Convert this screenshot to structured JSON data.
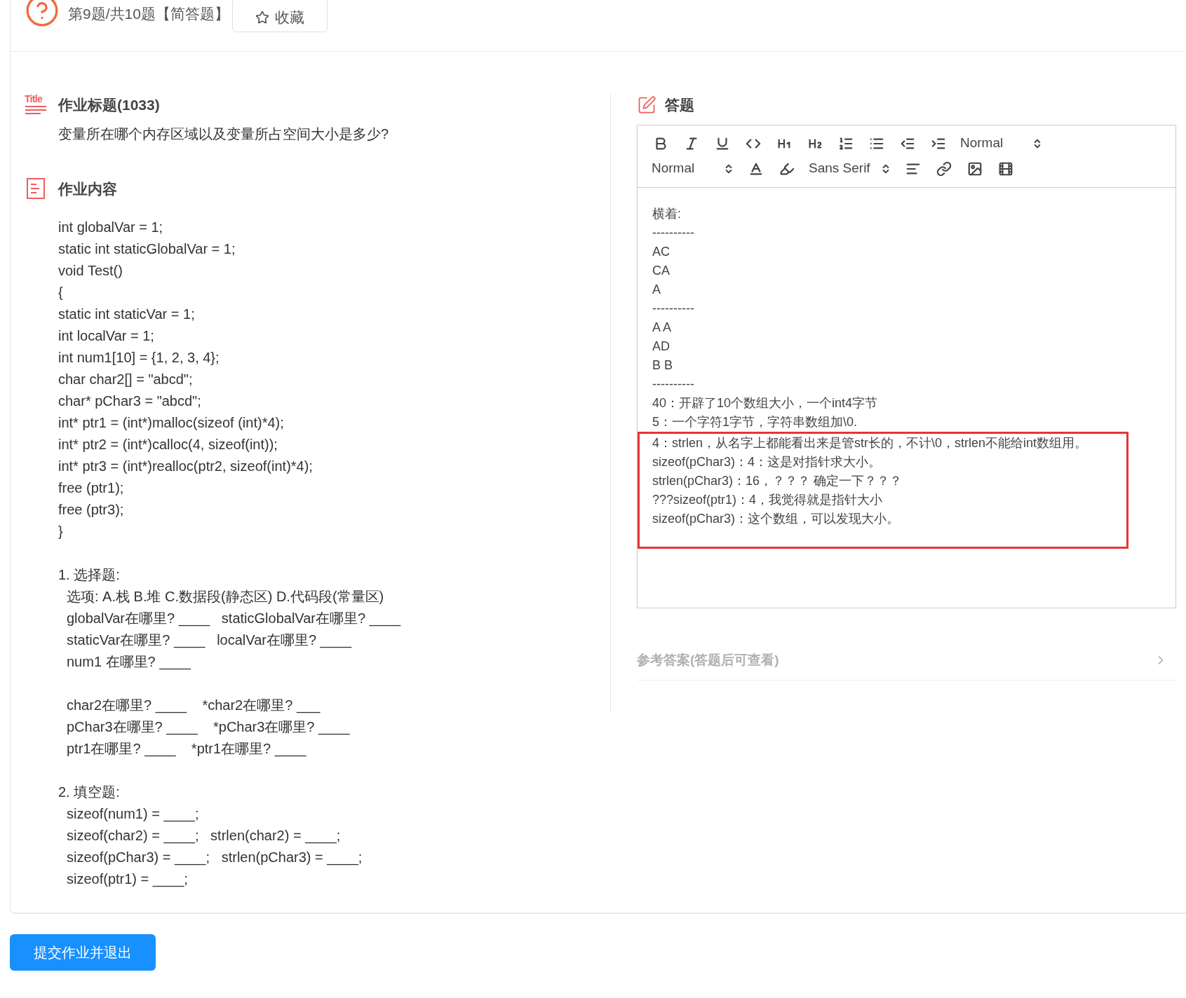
{
  "header": {
    "counter": "第9题/共10题【简答题】",
    "favorite": {
      "label": "收藏",
      "favorited": false
    }
  },
  "question": {
    "icon_label": "Title",
    "title": "作业标题(1033)",
    "text": "变量所在哪个内存区域以及变量所占空间大小是多少?"
  },
  "content": {
    "title": "作业内容",
    "lines": [
      {
        "kind": "code",
        "text": "int globalVar = 1;"
      },
      {
        "kind": "code",
        "text": "static int staticGlobalVar = 1;"
      },
      {
        "kind": "code",
        "text": "void Test()"
      },
      {
        "kind": "code",
        "text": "{"
      },
      {
        "kind": "code",
        "text": "static int staticVar = 1;"
      },
      {
        "kind": "code",
        "text": "int localVar = 1;"
      },
      {
        "kind": "code",
        "text": "int num1[10] = {1, 2, 3, 4};"
      },
      {
        "kind": "code",
        "text": "char char2[] = \"abcd\";"
      },
      {
        "kind": "code",
        "text": "char* pChar3 = \"abcd\";"
      },
      {
        "kind": "code",
        "text": "int* ptr1 = (int*)malloc(sizeof (int)*4);"
      },
      {
        "kind": "code",
        "text": "int* ptr2 = (int*)calloc(4, sizeof(int));"
      },
      {
        "kind": "code",
        "text": "int* ptr3 = (int*)realloc(ptr2, sizeof(int)*4);"
      },
      {
        "kind": "code",
        "text": "free (ptr1);"
      },
      {
        "kind": "code",
        "text": "free (ptr3);"
      },
      {
        "kind": "code",
        "text": "}"
      },
      {
        "kind": "gap"
      },
      {
        "kind": "code",
        "text": "1. 选择题:"
      },
      {
        "kind": "item",
        "text": "选项: A.栈 B.堆 C.数据段(静态区) D.代码段(常量区)"
      },
      {
        "kind": "item",
        "text": "globalVar在哪里? ____   staticGlobalVar在哪里? ____"
      },
      {
        "kind": "item",
        "text": "staticVar在哪里? ____   localVar在哪里? ____"
      },
      {
        "kind": "item",
        "text": "num1 在哪里? ____"
      },
      {
        "kind": "gap"
      },
      {
        "kind": "item",
        "text": "char2在哪里? ____    *char2在哪里? ___"
      },
      {
        "kind": "item",
        "text": "pChar3在哪里? ____    *pChar3在哪里? ____"
      },
      {
        "kind": "item",
        "text": "ptr1在哪里? ____    *ptr1在哪里? ____"
      },
      {
        "kind": "gap"
      },
      {
        "kind": "code",
        "text": "2. 填空题:"
      },
      {
        "kind": "item",
        "text": "sizeof(num1) = ____;"
      },
      {
        "kind": "item",
        "text": "sizeof(char2) = ____;   strlen(char2) = ____;"
      },
      {
        "kind": "item",
        "text": "sizeof(pChar3) = ____;   strlen(pChar3) = ____;"
      },
      {
        "kind": "item",
        "text": "sizeof(ptr1) = ____;"
      }
    ]
  },
  "answer": {
    "title": "答题",
    "toolbar": [
      [
        {
          "kind": "bold"
        },
        {
          "kind": "italic"
        },
        {
          "kind": "underline"
        },
        {
          "kind": "code"
        },
        {
          "kind": "h1"
        },
        {
          "kind": "h2"
        },
        {
          "kind": "ordered"
        },
        {
          "kind": "bullet"
        },
        {
          "kind": "outdent"
        },
        {
          "kind": "indent"
        },
        {
          "kind": "select",
          "label": "Normal"
        }
      ],
      [
        {
          "kind": "select",
          "label": "Normal"
        },
        {
          "kind": "color"
        },
        {
          "kind": "background"
        },
        {
          "kind": "select",
          "label": "Sans Serif"
        },
        {
          "kind": "align"
        },
        {
          "kind": "link"
        },
        {
          "kind": "image"
        },
        {
          "kind": "video"
        }
      ]
    ],
    "blocks": [
      {
        "highlighted": false,
        "lines": [
          "横着:",
          "----------",
          "AC",
          "CA",
          "A",
          "----------",
          "A A",
          "AD",
          "B B",
          "----------",
          "40：开辟了10个数组大小，一个int4字节",
          "5：一个字符1字节，字符串数组加\\0."
        ]
      },
      {
        "highlighted": true,
        "lines": [
          "4：strlen，从名字上都能看出来是管str长的，不计\\0，strlen不能给int数组用。",
          "sizeof(pChar3)：4：这是对指针求大小。",
          "strlen(pChar3)：16，？？？ 确定一下？？？",
          "???sizeof(ptr1)：4，我觉得就是指针大小",
          "sizeof(pChar3)：这个数组，可以发现大小。"
        ]
      }
    ],
    "reference": "参考答案(答题后可查看)"
  },
  "submit": "提交作业并退出"
}
